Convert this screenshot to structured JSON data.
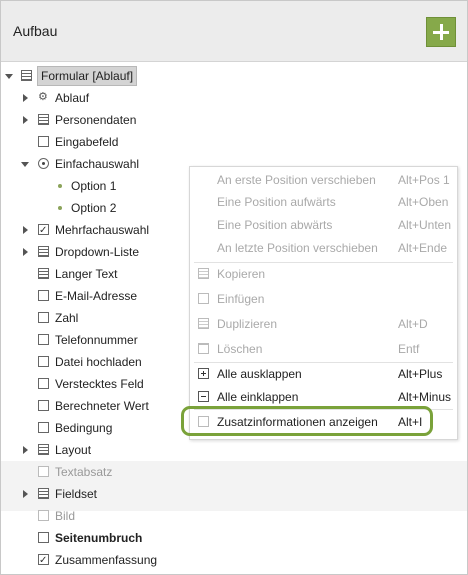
{
  "header": {
    "title": "Aufbau",
    "add_button_label": "+"
  },
  "tree": {
    "root": "Formular [Ablauf]",
    "items": [
      {
        "label": "Ablauf"
      },
      {
        "label": "Personendaten"
      },
      {
        "label": "Eingabefeld"
      },
      {
        "label": "Einfachauswahl"
      },
      {
        "label": "Option 1"
      },
      {
        "label": "Option 2"
      },
      {
        "label": "Mehrfachauswahl"
      },
      {
        "label": "Dropdown-Liste"
      },
      {
        "label": "Langer Text"
      },
      {
        "label": "E-Mail-Adresse"
      },
      {
        "label": "Zahl"
      },
      {
        "label": "Telefonnummer"
      },
      {
        "label": "Datei hochladen"
      },
      {
        "label": "Verstecktes Feld"
      },
      {
        "label": "Berechneter Wert"
      },
      {
        "label": "Bedingung"
      },
      {
        "label": "Layout"
      },
      {
        "label": "Textabsatz"
      },
      {
        "label": "Fieldset"
      },
      {
        "label": "Bild"
      },
      {
        "label": "Seitenumbruch"
      },
      {
        "label": "Zusammenfassung"
      }
    ]
  },
  "context_menu": {
    "items": [
      {
        "label": "An erste Position verschieben",
        "shortcut": "Alt+Pos 1"
      },
      {
        "label": "Eine Position aufwärts",
        "shortcut": "Alt+Oben"
      },
      {
        "label": "Eine Position abwärts",
        "shortcut": "Alt+Unten"
      },
      {
        "label": "An letzte Position verschieben",
        "shortcut": "Alt+Ende"
      },
      {
        "label": "Kopieren",
        "shortcut": ""
      },
      {
        "label": "Einfügen",
        "shortcut": ""
      },
      {
        "label": "Duplizieren",
        "shortcut": "Alt+D"
      },
      {
        "label": "Löschen",
        "shortcut": "Entf"
      },
      {
        "label": "Alle ausklappen",
        "shortcut": "Alt+Plus"
      },
      {
        "label": "Alle einklappen",
        "shortcut": "Alt+Minus"
      },
      {
        "label": "Zusatzinformationen anzeigen",
        "shortcut": "Alt+I"
      }
    ]
  },
  "colors": {
    "accent": "#86a94a",
    "highlight_ring": "#7aa23a"
  }
}
